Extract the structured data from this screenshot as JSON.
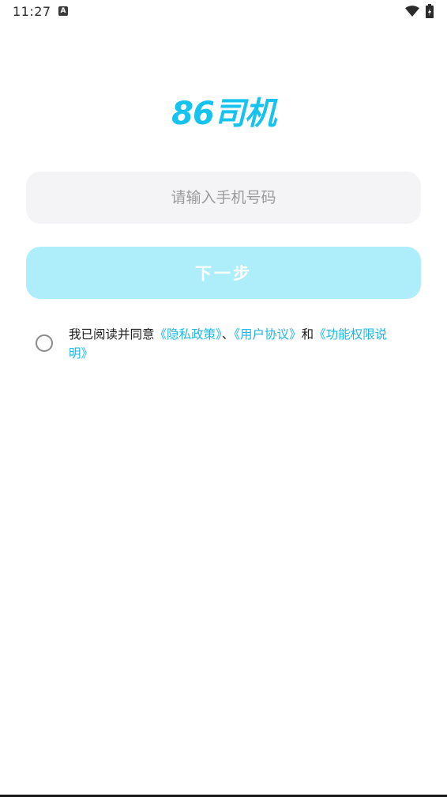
{
  "status_bar": {
    "time": "11:27",
    "notification_icon": "A",
    "icons": [
      "wifi-icon",
      "battery-icon"
    ]
  },
  "logo": {
    "text": "86司机",
    "color": "#16c3ee"
  },
  "phone_input": {
    "placeholder": "请输入手机号码",
    "value": ""
  },
  "next_button": {
    "label": "下一步",
    "color": "#aeeefb"
  },
  "agreement": {
    "prefix": "我已阅读并同意",
    "privacy_link": "《隐私政策》",
    "sep1": "、",
    "user_link": "《用户协议》",
    "sep2": "和",
    "permission_link": "《功能权限说明》",
    "link_color": "#1ab8e8",
    "checked": false
  }
}
